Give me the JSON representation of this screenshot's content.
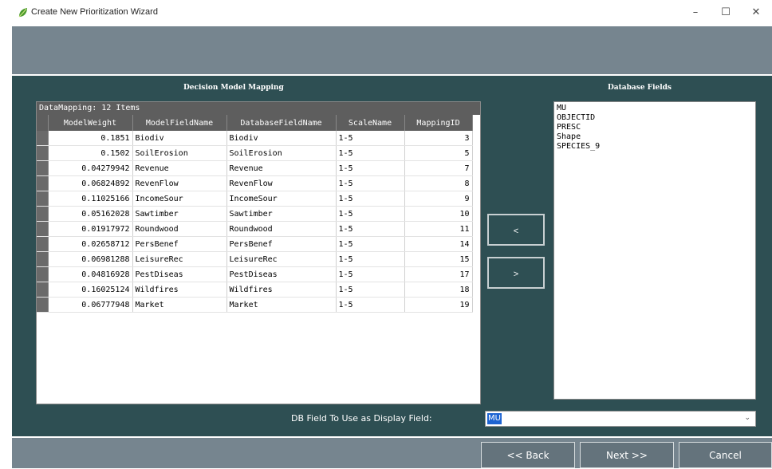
{
  "window": {
    "title": "Create New Prioritization Wizard",
    "min_glyph": "–",
    "max_glyph": "☐",
    "close_glyph": "✕"
  },
  "main": {
    "mapping_heading": "Decision Model Mapping",
    "fields_heading": "Database Fields",
    "grid_caption": "DataMapping: 12 Items",
    "columns": [
      "ModelWeight",
      "ModelFieldName",
      "DatabaseFieldName",
      "ScaleName",
      "MappingID"
    ],
    "rows": [
      [
        "0.1851",
        "Biodiv",
        "Biodiv",
        "1-5",
        "3"
      ],
      [
        "0.1502",
        "SoilErosion",
        "SoilErosion",
        "1-5",
        "5"
      ],
      [
        "0.04279942",
        "Revenue",
        "Revenue",
        "1-5",
        "7"
      ],
      [
        "0.06824892",
        "RevenFlow",
        "RevenFlow",
        "1-5",
        "8"
      ],
      [
        "0.11025166",
        "IncomeSour",
        "IncomeSour",
        "1-5",
        "9"
      ],
      [
        "0.05162028",
        "Sawtimber",
        "Sawtimber",
        "1-5",
        "10"
      ],
      [
        "0.01917972",
        "Roundwood",
        "Roundwood",
        "1-5",
        "11"
      ],
      [
        "0.02658712",
        "PersBenef",
        "PersBenef",
        "1-5",
        "14"
      ],
      [
        "0.06981288",
        "LeisureRec",
        "LeisureRec",
        "1-5",
        "15"
      ],
      [
        "0.04816928",
        "PestDiseas",
        "PestDiseas",
        "1-5",
        "17"
      ],
      [
        "0.16025124",
        "Wildfires",
        "Wildfires",
        "1-5",
        "18"
      ],
      [
        "0.06777948",
        "Market",
        "Market",
        "1-5",
        "19"
      ]
    ],
    "move_left_label": "<",
    "move_right_label": ">",
    "database_fields": [
      "MU",
      "OBJECTID",
      "PRESC",
      "Shape",
      "SPECIES_9"
    ],
    "display_field_label": "DB Field To Use as Display Field:",
    "display_field_value": "MU"
  },
  "footer": {
    "back_label": "<< Back",
    "next_label": "Next >>",
    "cancel_label": "Cancel"
  },
  "icons": {
    "app": "leaf-icon",
    "dropdown": "chevron-down-icon"
  },
  "colors": {
    "panel": "#2e4f53",
    "band": "#76858f",
    "grid_header": "#5e5e5e",
    "selection": "#1e64d2"
  }
}
